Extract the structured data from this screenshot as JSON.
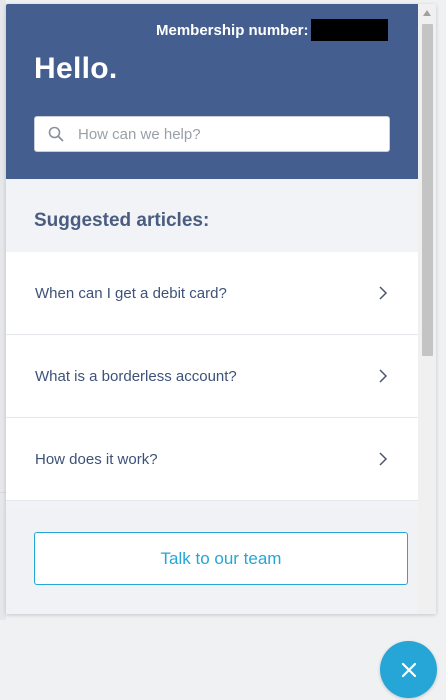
{
  "header": {
    "membership_label": "Membership number:",
    "greeting": "Hello.",
    "search_placeholder": "How can we help?"
  },
  "suggested": {
    "title": "Suggested articles:",
    "articles": [
      {
        "label": "When can I get a debit card?"
      },
      {
        "label": "What is a borderless account?"
      },
      {
        "label": "How does it work?"
      }
    ]
  },
  "footer": {
    "talk_label": "Talk to our team"
  },
  "colors": {
    "header_bg": "#445f8f",
    "accent": "#25a6d6",
    "article_text": "#3d5279"
  },
  "icons": {
    "search": "search-icon",
    "chevron": "chevron-right-icon",
    "close": "close-icon"
  }
}
